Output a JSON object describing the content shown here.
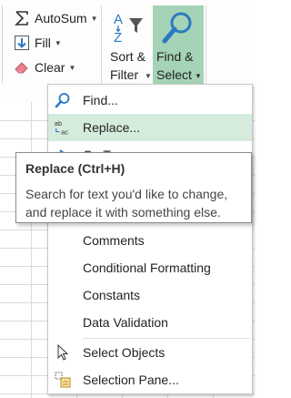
{
  "ribbon": {
    "autosum": {
      "label": "AutoSum",
      "icon": "sigma-icon"
    },
    "fill": {
      "label": "Fill",
      "icon": "fill-down-arrow-icon"
    },
    "clear": {
      "label": "Clear",
      "icon": "eraser-icon"
    },
    "sort_filter": {
      "line1": "Sort &",
      "line2": "Filter",
      "icon": "sort-az-funnel-icon"
    },
    "find_select": {
      "line1": "Find &",
      "line2": "Select",
      "icon": "magnifier-icon",
      "active_color": "#a5d3b5"
    }
  },
  "menu": {
    "items": [
      {
        "label": "Find...",
        "icon": "magnifier-icon"
      },
      {
        "label": "Replace...",
        "icon": "ab-ac-replace-icon",
        "highlighted": true
      },
      {
        "label": "Go To...",
        "icon": "arrow-right-icon"
      },
      {
        "label": "Comments"
      },
      {
        "label": "Conditional Formatting"
      },
      {
        "label": "Constants"
      },
      {
        "label": "Data Validation"
      },
      {
        "label": "Select Objects",
        "icon": "cursor-arrow-icon"
      },
      {
        "label": "Selection Pane...",
        "icon": "selection-pane-icon"
      }
    ]
  },
  "tooltip": {
    "title": "Replace (Ctrl+H)",
    "body": "Search for text you'd like to change, and replace it with something else."
  },
  "colors": {
    "highlight": "#d5ecdc",
    "accent_blue": "#2b78c2"
  }
}
